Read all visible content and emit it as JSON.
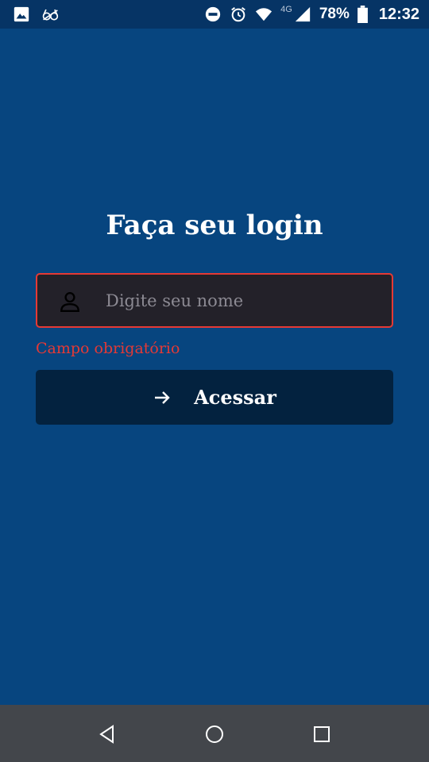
{
  "status_bar": {
    "icons_left": [
      "gallery-icon",
      "glasses-icon"
    ],
    "icons_right": [
      "do-not-disturb-icon",
      "alarm-icon",
      "wifi-icon",
      "signal-icon",
      "battery-icon"
    ],
    "network": "4G",
    "battery": "78%",
    "time": "12:32"
  },
  "login": {
    "title": "Faça seu login",
    "name_placeholder": "Digite seu nome",
    "name_value": "",
    "error": "Campo obrigatório",
    "submit_label": "Acessar"
  },
  "colors": {
    "background": "#07457f",
    "status_bar": "#063465",
    "input_bg": "#232129",
    "error": "#e53935",
    "button_bg": "#03223f",
    "nav_bar": "#43464b"
  },
  "nav_bar": {
    "buttons": [
      "back-icon",
      "home-icon",
      "recents-icon"
    ]
  }
}
